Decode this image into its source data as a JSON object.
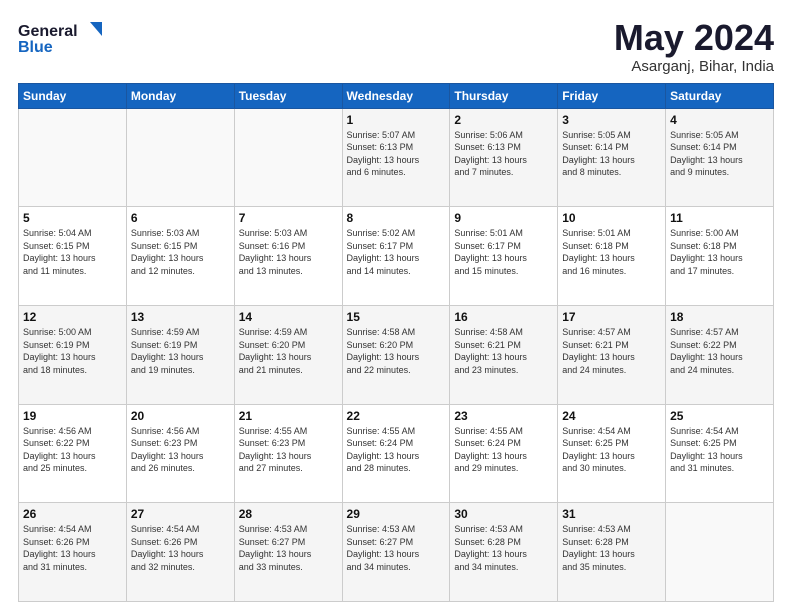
{
  "logo": {
    "line1": "General",
    "line2": "Blue"
  },
  "header": {
    "month": "May 2024",
    "location": "Asarganj, Bihar, India"
  },
  "weekdays": [
    "Sunday",
    "Monday",
    "Tuesday",
    "Wednesday",
    "Thursday",
    "Friday",
    "Saturday"
  ],
  "weeks": [
    [
      {
        "day": "",
        "info": ""
      },
      {
        "day": "",
        "info": ""
      },
      {
        "day": "",
        "info": ""
      },
      {
        "day": "1",
        "info": "Sunrise: 5:07 AM\nSunset: 6:13 PM\nDaylight: 13 hours\nand 6 minutes."
      },
      {
        "day": "2",
        "info": "Sunrise: 5:06 AM\nSunset: 6:13 PM\nDaylight: 13 hours\nand 7 minutes."
      },
      {
        "day": "3",
        "info": "Sunrise: 5:05 AM\nSunset: 6:14 PM\nDaylight: 13 hours\nand 8 minutes."
      },
      {
        "day": "4",
        "info": "Sunrise: 5:05 AM\nSunset: 6:14 PM\nDaylight: 13 hours\nand 9 minutes."
      }
    ],
    [
      {
        "day": "5",
        "info": "Sunrise: 5:04 AM\nSunset: 6:15 PM\nDaylight: 13 hours\nand 11 minutes."
      },
      {
        "day": "6",
        "info": "Sunrise: 5:03 AM\nSunset: 6:15 PM\nDaylight: 13 hours\nand 12 minutes."
      },
      {
        "day": "7",
        "info": "Sunrise: 5:03 AM\nSunset: 6:16 PM\nDaylight: 13 hours\nand 13 minutes."
      },
      {
        "day": "8",
        "info": "Sunrise: 5:02 AM\nSunset: 6:17 PM\nDaylight: 13 hours\nand 14 minutes."
      },
      {
        "day": "9",
        "info": "Sunrise: 5:01 AM\nSunset: 6:17 PM\nDaylight: 13 hours\nand 15 minutes."
      },
      {
        "day": "10",
        "info": "Sunrise: 5:01 AM\nSunset: 6:18 PM\nDaylight: 13 hours\nand 16 minutes."
      },
      {
        "day": "11",
        "info": "Sunrise: 5:00 AM\nSunset: 6:18 PM\nDaylight: 13 hours\nand 17 minutes."
      }
    ],
    [
      {
        "day": "12",
        "info": "Sunrise: 5:00 AM\nSunset: 6:19 PM\nDaylight: 13 hours\nand 18 minutes."
      },
      {
        "day": "13",
        "info": "Sunrise: 4:59 AM\nSunset: 6:19 PM\nDaylight: 13 hours\nand 19 minutes."
      },
      {
        "day": "14",
        "info": "Sunrise: 4:59 AM\nSunset: 6:20 PM\nDaylight: 13 hours\nand 21 minutes."
      },
      {
        "day": "15",
        "info": "Sunrise: 4:58 AM\nSunset: 6:20 PM\nDaylight: 13 hours\nand 22 minutes."
      },
      {
        "day": "16",
        "info": "Sunrise: 4:58 AM\nSunset: 6:21 PM\nDaylight: 13 hours\nand 23 minutes."
      },
      {
        "day": "17",
        "info": "Sunrise: 4:57 AM\nSunset: 6:21 PM\nDaylight: 13 hours\nand 24 minutes."
      },
      {
        "day": "18",
        "info": "Sunrise: 4:57 AM\nSunset: 6:22 PM\nDaylight: 13 hours\nand 24 minutes."
      }
    ],
    [
      {
        "day": "19",
        "info": "Sunrise: 4:56 AM\nSunset: 6:22 PM\nDaylight: 13 hours\nand 25 minutes."
      },
      {
        "day": "20",
        "info": "Sunrise: 4:56 AM\nSunset: 6:23 PM\nDaylight: 13 hours\nand 26 minutes."
      },
      {
        "day": "21",
        "info": "Sunrise: 4:55 AM\nSunset: 6:23 PM\nDaylight: 13 hours\nand 27 minutes."
      },
      {
        "day": "22",
        "info": "Sunrise: 4:55 AM\nSunset: 6:24 PM\nDaylight: 13 hours\nand 28 minutes."
      },
      {
        "day": "23",
        "info": "Sunrise: 4:55 AM\nSunset: 6:24 PM\nDaylight: 13 hours\nand 29 minutes."
      },
      {
        "day": "24",
        "info": "Sunrise: 4:54 AM\nSunset: 6:25 PM\nDaylight: 13 hours\nand 30 minutes."
      },
      {
        "day": "25",
        "info": "Sunrise: 4:54 AM\nSunset: 6:25 PM\nDaylight: 13 hours\nand 31 minutes."
      }
    ],
    [
      {
        "day": "26",
        "info": "Sunrise: 4:54 AM\nSunset: 6:26 PM\nDaylight: 13 hours\nand 31 minutes."
      },
      {
        "day": "27",
        "info": "Sunrise: 4:54 AM\nSunset: 6:26 PM\nDaylight: 13 hours\nand 32 minutes."
      },
      {
        "day": "28",
        "info": "Sunrise: 4:53 AM\nSunset: 6:27 PM\nDaylight: 13 hours\nand 33 minutes."
      },
      {
        "day": "29",
        "info": "Sunrise: 4:53 AM\nSunset: 6:27 PM\nDaylight: 13 hours\nand 34 minutes."
      },
      {
        "day": "30",
        "info": "Sunrise: 4:53 AM\nSunset: 6:28 PM\nDaylight: 13 hours\nand 34 minutes."
      },
      {
        "day": "31",
        "info": "Sunrise: 4:53 AM\nSunset: 6:28 PM\nDaylight: 13 hours\nand 35 minutes."
      },
      {
        "day": "",
        "info": ""
      }
    ]
  ]
}
